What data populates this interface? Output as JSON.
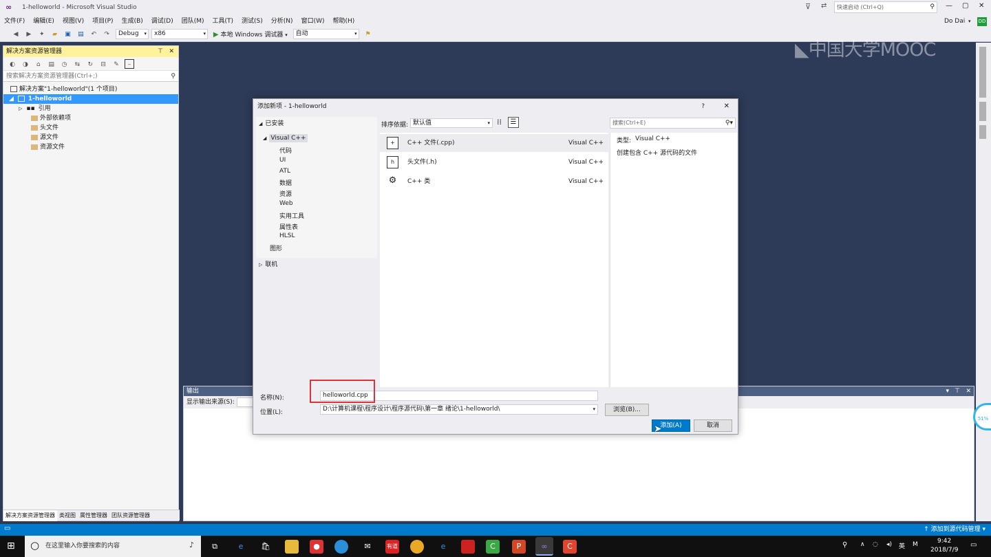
{
  "window": {
    "title": "1-helloworld - Microsoft Visual Studio",
    "quick_launch_placeholder": "快速启动 (Ctrl+Q)",
    "user_name": "Do Dai",
    "user_initials": "DD"
  },
  "menu": [
    "文件(F)",
    "编辑(E)",
    "视图(V)",
    "项目(P)",
    "生成(B)",
    "调试(D)",
    "团队(M)",
    "工具(T)",
    "测试(S)",
    "分析(N)",
    "窗口(W)",
    "帮助(H)"
  ],
  "toolbar": {
    "config": "Debug",
    "platform": "x86",
    "run_label": "本地 Windows 调试器",
    "run_mode": "自动"
  },
  "watermark": "中国大学MOOC",
  "solution_explorer": {
    "title": "解决方案资源管理器",
    "search_placeholder": "搜索解决方案资源管理器(Ctrl+;)",
    "tree": {
      "solution": "解决方案\"1-helloworld\"(1 个项目)",
      "project": "1-helloworld",
      "references": "引用",
      "external": "外部依赖项",
      "headers": "头文件",
      "sources": "源文件",
      "resources": "资源文件"
    },
    "tabs": [
      "解决方案资源管理器",
      "类视图",
      "属性管理器",
      "团队资源管理器"
    ]
  },
  "output": {
    "title": "输出",
    "source_label": "显示输出来源(S):"
  },
  "dialog": {
    "title": "添加新项 - 1-helloworld",
    "help": "?",
    "installed": "已安装",
    "sort_label": "排序依据:",
    "sort_value": "默认值",
    "search_placeholder": "搜索(Ctrl+E)",
    "categories": {
      "root": "Visual C++",
      "children": [
        "代码",
        "UI",
        "ATL",
        "数据",
        "资源",
        "Web",
        "实用工具",
        "属性表",
        "HLSL"
      ],
      "graphics": "图形",
      "online": "联机"
    },
    "templates": [
      {
        "name": "C++ 文件(.cpp)",
        "type": "Visual C++",
        "icon": "cpp-file-icon"
      },
      {
        "name": "头文件(.h)",
        "type": "Visual C++",
        "icon": "header-file-icon"
      },
      {
        "name": "C++ 类",
        "type": "Visual C++",
        "icon": "class-icon"
      }
    ],
    "detail_type_label": "类型:",
    "detail_type_value": "Visual C++",
    "detail_desc": "创建包含 C++ 源代码的文件",
    "name_label": "名称(N):",
    "name_value": "helloworld.cpp",
    "location_label": "位置(L):",
    "location_value": "D:\\计算机课程\\程序设计\\程序源代码\\第一章 绪论\\1-helloworld\\",
    "browse_label": "浏览(B)...",
    "add_label": "添加(A)",
    "cancel_label": "取消"
  },
  "statusbar": {
    "right_text": "↑ 添加到源代码管理 ▾"
  },
  "taskbar": {
    "search_placeholder": "在这里输入你要搜索的内容",
    "time": "9:42",
    "date": "2018/7/9",
    "lang": "英"
  },
  "progress_badge": "51%",
  "colors": {
    "accent": "#007acc",
    "highlight_box": "#e0303a",
    "background": "#2d3a58"
  }
}
